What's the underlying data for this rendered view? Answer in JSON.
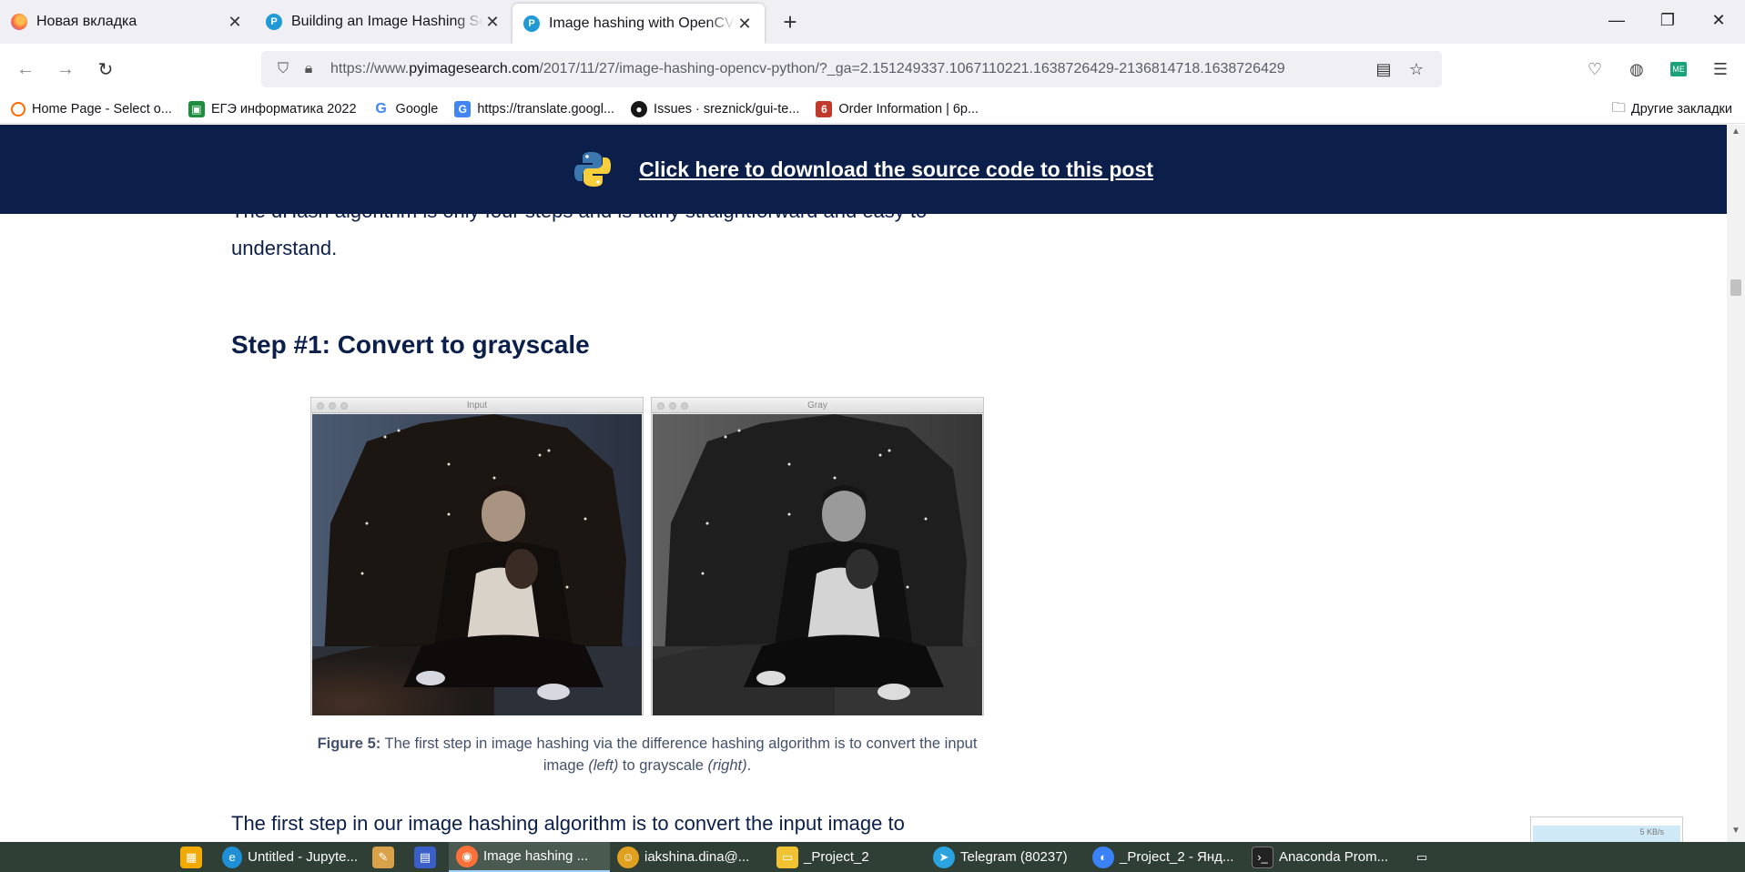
{
  "browser": {
    "tabs": [
      {
        "title": "Новая вкладка",
        "icon": "firefox-icon",
        "active": false
      },
      {
        "title": "Building an Image Hashing Sea",
        "icon": "pyimagesearch-icon",
        "active": false
      },
      {
        "title": "Image hashing with OpenCV an",
        "icon": "pyimagesearch-icon",
        "active": true
      }
    ],
    "url_prefix": "https://www.",
    "url_domain": "pyimagesearch.com",
    "url_path": "/2017/11/27/image-hashing-opencv-python/?_ga=2.151249337.1067110221.1638726429-2136814718.1638726429",
    "bookmarks": [
      {
        "label": "Home Page - Select o...",
        "icon": "swirl-icon",
        "color": "#ff6a00"
      },
      {
        "label": "ЕГЭ информатика 2022",
        "icon": "classroom-icon",
        "color": "#1e8e3e"
      },
      {
        "label": "Google",
        "icon": "google-icon",
        "color": "#4285f4"
      },
      {
        "label": "https://translate.googl...",
        "icon": "translate-icon",
        "color": "#4285f4"
      },
      {
        "label": "Issues · sreznick/gui-te...",
        "icon": "github-icon",
        "color": "#181717"
      },
      {
        "label": "Order Information | 6p...",
        "icon": "order-icon",
        "color": "#c0392b"
      }
    ],
    "other_bookmarks": "Другие закладки"
  },
  "page": {
    "banner_link": "Click here to download the source code to this post",
    "para_top": "The dHash algorithm is only four steps and is fairly straightforward and easy to understand.",
    "heading": "Step #1: Convert to grayscale",
    "figure_left_title": "Input",
    "figure_right_title": "Gray",
    "caption_label": "Figure 5:",
    "caption_part1": " The first step in image hashing via the difference hashing algorithm is to convert the input image ",
    "caption_left": "(left)",
    "caption_part2": " to grayscale ",
    "caption_right": "(right)",
    "caption_end": ".",
    "para_bottom": "The first step in our image hashing algorithm is to convert the input image to",
    "net_speed": "5 KB/s"
  },
  "taskbar": [
    {
      "label": "",
      "icon": "store-icon",
      "color": "#f2a900"
    },
    {
      "label": "Untitled - Jupyte...",
      "icon": "edge-icon",
      "color": "#1f8fd6"
    },
    {
      "label": "",
      "icon": "paint-icon",
      "color": "#d9a24a"
    },
    {
      "label": "",
      "icon": "document-app-icon",
      "color": "#3a5fc8"
    },
    {
      "label": "Image hashing ...",
      "icon": "firefox-icon",
      "color": "#ff7139",
      "active": true
    },
    {
      "label": "iakshina.dina@...",
      "icon": "mail-client-icon",
      "color": "#e0a020"
    },
    {
      "label": "_Project_2",
      "icon": "folder-icon",
      "color": "#f1c232"
    },
    {
      "label": "Telegram (80237)",
      "icon": "telegram-icon",
      "color": "#2aa3e0"
    },
    {
      "label": "_Project_2 - Янд...",
      "icon": "yandex-disk-icon",
      "color": "#3b82f6"
    },
    {
      "label": "Anaconda Prom...",
      "icon": "terminal-icon",
      "color": "#222222"
    },
    {
      "label": "",
      "icon": "camera-icon",
      "color": "#444444"
    }
  ]
}
